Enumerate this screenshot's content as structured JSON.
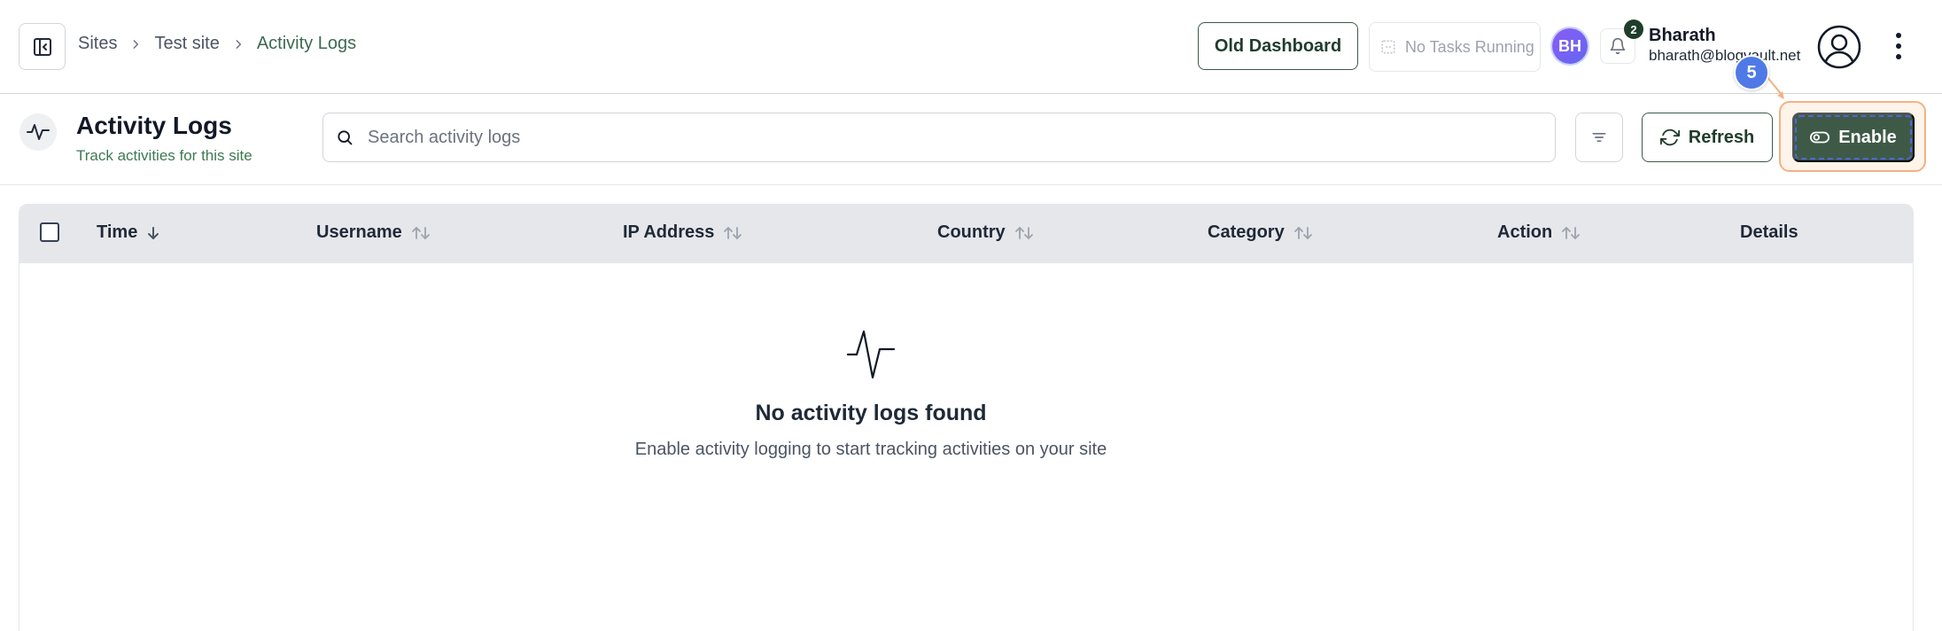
{
  "breadcrumb": {
    "items": [
      "Sites",
      "Test site"
    ],
    "current": "Activity Logs"
  },
  "header": {
    "old_dashboard_label": "Old Dashboard",
    "tasks_status": "No Tasks Running",
    "avatar_initials": "BH",
    "notification_count": "2",
    "user_name": "Bharath",
    "user_email": "bharath@blogvault.net"
  },
  "page": {
    "title": "Activity Logs",
    "subtitle": "Track activities for this site",
    "search_placeholder": "Search activity logs",
    "search_value": "",
    "refresh_label": "Refresh",
    "enable_label": "Enable",
    "step_number": "5"
  },
  "table": {
    "columns": [
      {
        "label": "Time",
        "sort": "desc"
      },
      {
        "label": "Username",
        "sort": "both"
      },
      {
        "label": "IP Address",
        "sort": "both"
      },
      {
        "label": "Country",
        "sort": "both"
      },
      {
        "label": "Category",
        "sort": "both"
      },
      {
        "label": "Action",
        "sort": "both"
      },
      {
        "label": "Details",
        "sort": "none"
      }
    ],
    "empty_title": "No activity logs found",
    "empty_description": "Enable activity logging to start tracking activities on your site"
  },
  "colors": {
    "accent_green": "#3e5a47",
    "link_green": "#3d6b4f",
    "step_blue": "#4f79e6",
    "highlight_orange": "#f4b183"
  },
  "icons": {
    "sidebar_toggle": "panel-left-icon",
    "breadcrumb_separator": "chevron-right-icon",
    "tasks": "tasks-icon",
    "bell": "bell-icon",
    "user": "user-circle-icon",
    "menu": "kebab-menu-icon",
    "activity": "activity-icon",
    "search": "search-icon",
    "filter": "filter-icon",
    "refresh": "refresh-icon",
    "toggle": "toggle-icon",
    "sort": "sort-icon"
  }
}
